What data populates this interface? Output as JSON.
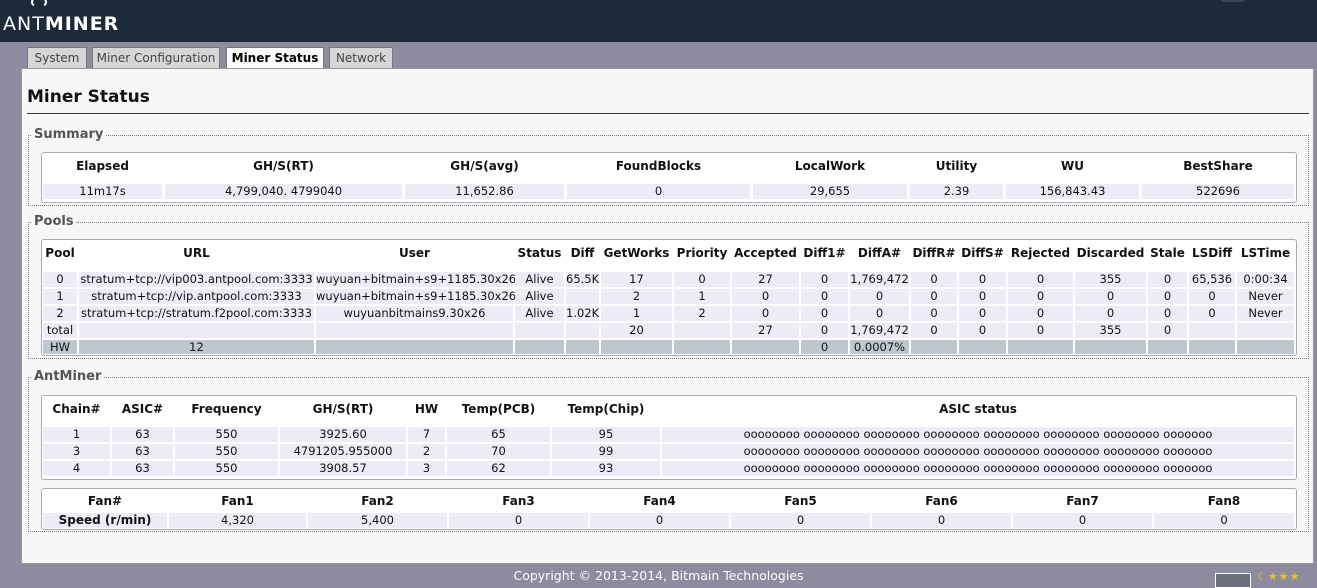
{
  "brand": {
    "prefix": "ANT",
    "suffix": "MINER"
  },
  "tabs": [
    {
      "label": "System"
    },
    {
      "label": "Miner Configuration"
    },
    {
      "label": "Miner Status"
    },
    {
      "label": "Network"
    }
  ],
  "page_title": "Miner Status",
  "summary": {
    "legend": "Summary",
    "headers": [
      "Elapsed",
      "GH/S(RT)",
      "GH/S(avg)",
      "FoundBlocks",
      "LocalWork",
      "Utility",
      "WU",
      "BestShare"
    ],
    "values": [
      "11m17s",
      "4,799,040. 4799040",
      "11,652.86",
      "0",
      "29,655",
      "2.39",
      "156,843.43",
      "522696"
    ]
  },
  "pools": {
    "legend": "Pools",
    "headers": [
      "Pool",
      "URL",
      "User",
      "Status",
      "Diff",
      "GetWorks",
      "Priority",
      "Accepted",
      "Diff1#",
      "DiffA#",
      "DiffR#",
      "DiffS#",
      "Rejected",
      "Discarded",
      "Stale",
      "LSDiff",
      "LSTime"
    ],
    "rows": [
      [
        "0",
        "stratum+tcp://vip003.antpool.com:3333",
        "wuyuan+bitmain+s9+1185.30x26",
        "Alive",
        "65.5K",
        "17",
        "0",
        "27",
        "0",
        "1,769,472",
        "0",
        "0",
        "0",
        "355",
        "0",
        "65,536",
        "0:00:34"
      ],
      [
        "1",
        "stratum+tcp://vip.antpool.com:3333",
        "wuyuan+bitmain+s9+1185.30x26",
        "Alive",
        "",
        "2",
        "1",
        "0",
        "0",
        "0",
        "0",
        "0",
        "0",
        "0",
        "0",
        "0",
        "Never"
      ],
      [
        "2",
        "stratum+tcp://stratum.f2pool.com:3333",
        "wuyuanbitmains9.30x26",
        "Alive",
        "1.02K",
        "1",
        "2",
        "0",
        "0",
        "0",
        "0",
        "0",
        "0",
        "0",
        "0",
        "0",
        "Never"
      ],
      [
        "total",
        "",
        "",
        "",
        "",
        "20",
        "",
        "27",
        "0",
        "1,769,472",
        "0",
        "0",
        "0",
        "355",
        "0",
        "",
        ""
      ]
    ],
    "hw_row": {
      "label": "HW",
      "count": "12",
      "diff1": "0",
      "rate": "0.0007%"
    }
  },
  "antminer": {
    "legend": "AntMiner",
    "headers": [
      "Chain#",
      "ASIC#",
      "Frequency",
      "GH/S(RT)",
      "HW",
      "Temp(PCB)",
      "Temp(Chip)",
      "ASIC status"
    ],
    "rows": [
      [
        "1",
        "63",
        "550",
        "3925.60",
        "7",
        "65",
        "95",
        "oooooooo oooooooo oooooooo oooooooo oooooooo oooooooo oooooooo ooooooo"
      ],
      [
        "3",
        "63",
        "550",
        "4791205.955000",
        "2",
        "70",
        "99",
        "oooooooo oooooooo oooooooo oooooooo oooooooo oooooooo oooooooo ooooooo"
      ],
      [
        "4",
        "63",
        "550",
        "3908.57",
        "3",
        "62",
        "93",
        "oooooooo oooooooo oooooooo oooooooo oooooooo oooooooo oooooooo ooooooo"
      ]
    ],
    "fan_headers": [
      "Fan#",
      "Fan1",
      "Fan2",
      "Fan3",
      "Fan4",
      "Fan5",
      "Fan6",
      "Fan7",
      "Fan8"
    ],
    "fan_values": [
      "Speed (r/min)",
      "4,320",
      "5,400",
      "0",
      "0",
      "0",
      "0",
      "0",
      "0"
    ]
  },
  "footer": "Copyright © 2013-2014, Bitmain Technologies",
  "rating_stars": "☾★★★"
}
